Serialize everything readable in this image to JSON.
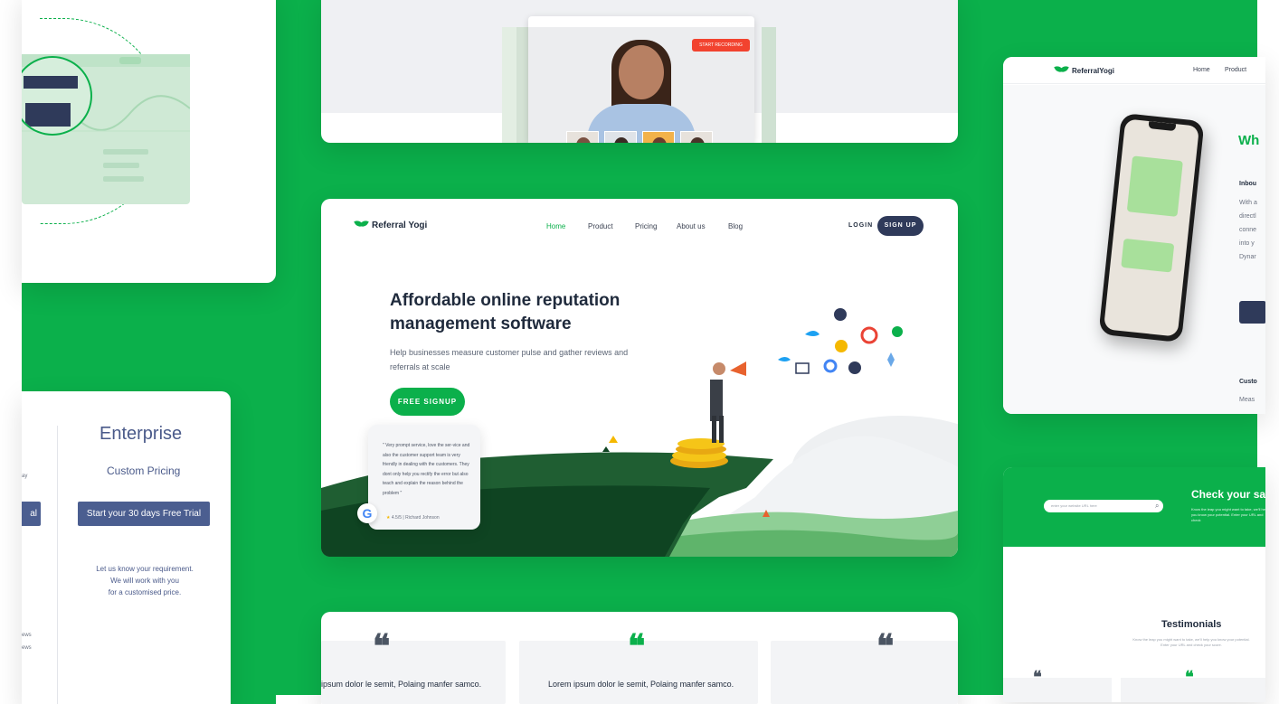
{
  "colors": {
    "brand_green": "#0bb04b",
    "navy": "#2f3a5a",
    "slate_blue": "#4b5e90",
    "text_dark": "#1f2a3c",
    "recording_red": "#f2432f"
  },
  "video_mockup": {
    "record_label": "START RECORDING"
  },
  "hero": {
    "logo": "Referral Yogi",
    "nav": [
      "Home",
      "Product",
      "Pricing",
      "About us",
      "Blog"
    ],
    "login": "LOGIN",
    "signup": "SIGN UP",
    "headline": "Affordable online reputation management software",
    "subtext": "Help businesses measure customer pulse and gather reviews and referrals at scale",
    "cta": "FREE SIGNUP",
    "review": {
      "text": "\" Very prompt service, love the ser-vice and also the customer support team is very friendly in dealing with the customers. They dont only help you rectify the error but also teach and explain the reason behind the problem \"",
      "rating": "4.5/5",
      "reviewer": "Richard Johnson"
    }
  },
  "testimonials_strip": {
    "texts": [
      "ipsum dolor le semit, Polaing manfer samco.",
      "Lorem ipsum dolor le semit, Polaing manfer samco."
    ]
  },
  "enterprise": {
    "title": "Enterprise",
    "subtitle": "Custom Pricing",
    "button": "Start your 30 days Free Trial",
    "left_button_fragment": "al",
    "left_text_fragment": "ay",
    "note": "Let us know your requirement.\nWe will work with you\nfor a customised price.",
    "left_fragments": [
      "ews",
      "ews"
    ]
  },
  "referral_card": {
    "logo": "ReferralYogi",
    "nav": [
      "Home",
      "Product"
    ],
    "heading_fragment": "Wh",
    "texts": [
      "Inbou",
      "With a",
      "directl",
      "conne",
      "into y",
      "Dynar",
      "Custo",
      "Meas"
    ]
  },
  "check_card": {
    "input_placeholder": "enter your website URL here",
    "title": "Check your sa",
    "desc": "Know the leap you might want to take, we'll help you know your potential. Enter your URL and check",
    "testimonials_title": "Testimonials",
    "testimonials_desc": "Know the leap you might want to take, we'll help you know your potential. Enter your URL and check your score."
  },
  "icons": [
    "search-icon",
    "quote-icon",
    "google-icon",
    "twitter-icon",
    "megaphone-icon",
    "leaf-logo-icon"
  ]
}
